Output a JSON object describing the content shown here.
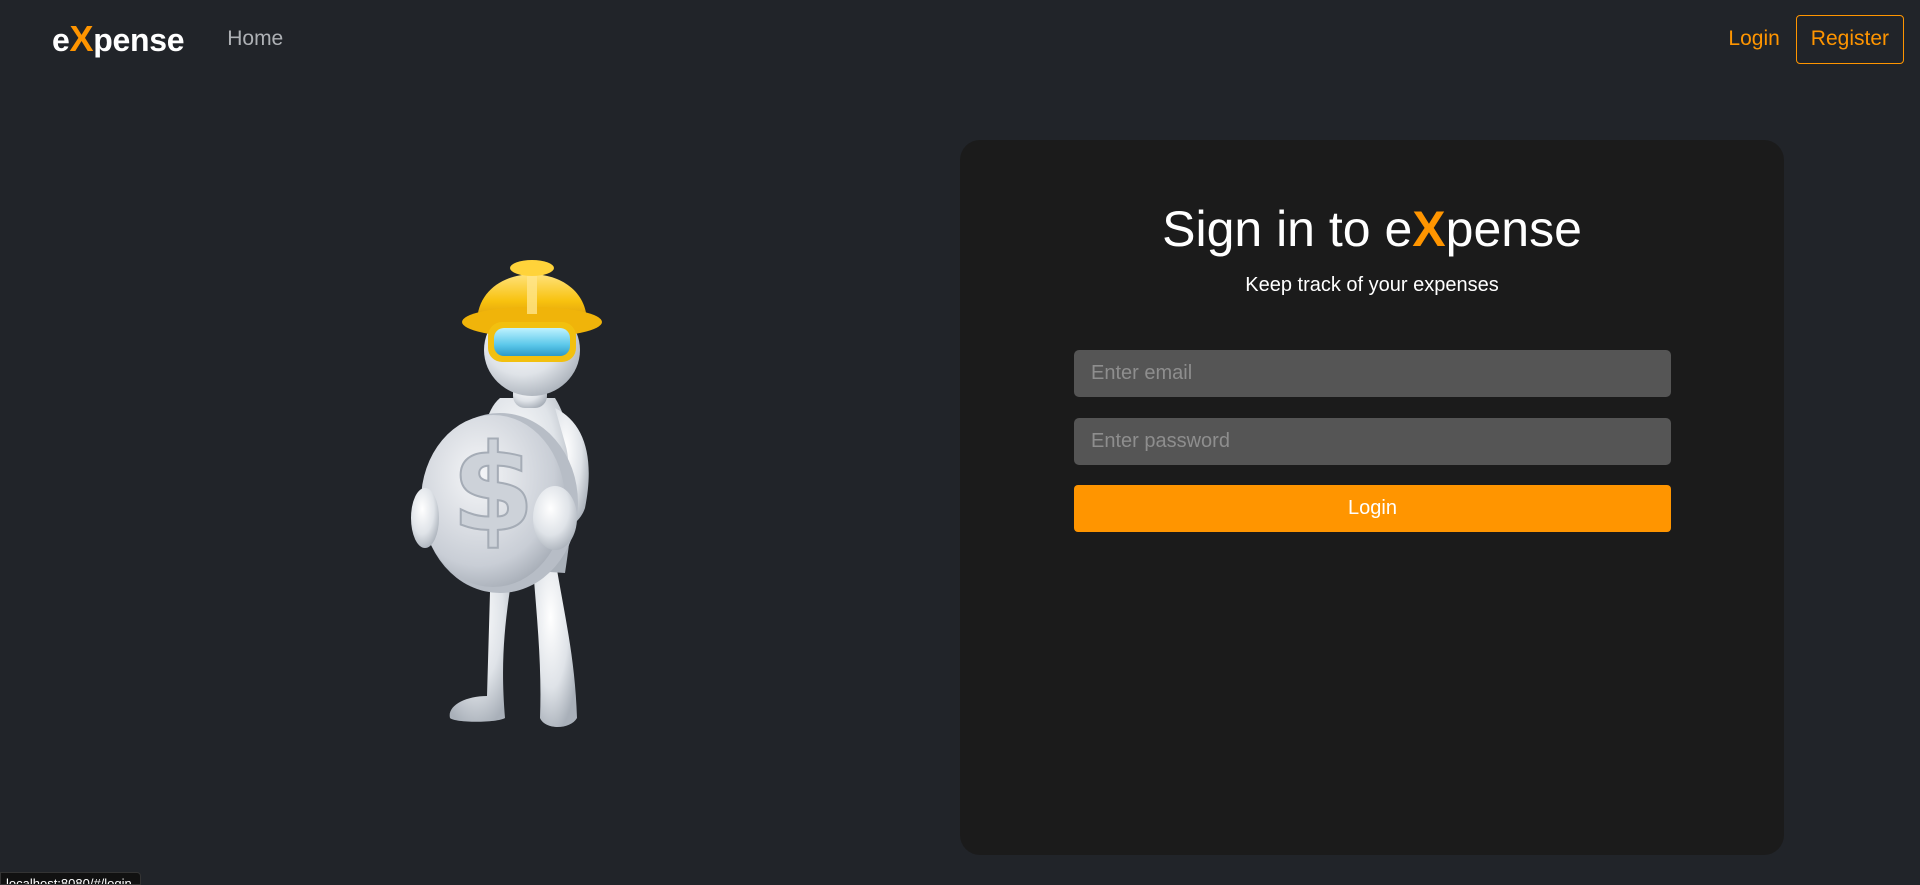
{
  "navbar": {
    "brand_prefix": "e",
    "brand_x": "X",
    "brand_suffix": "pense",
    "home_label": "Home",
    "login_label": "Login",
    "register_label": "Register"
  },
  "card": {
    "title_prefix": "Sign in to e",
    "title_x": "X",
    "title_suffix": "pense",
    "subtitle": "Keep track of your expenses",
    "email_placeholder": "Enter email",
    "password_placeholder": "Enter password",
    "login_button": "Login"
  },
  "status_bar": {
    "url": "localhost:8080/#/login"
  },
  "colors": {
    "background": "#212429",
    "accent": "#ff9500",
    "card": "#1b1b1b",
    "input": "#555555"
  },
  "icons": {
    "hero": "worker-with-dollar-coin-illustration"
  }
}
